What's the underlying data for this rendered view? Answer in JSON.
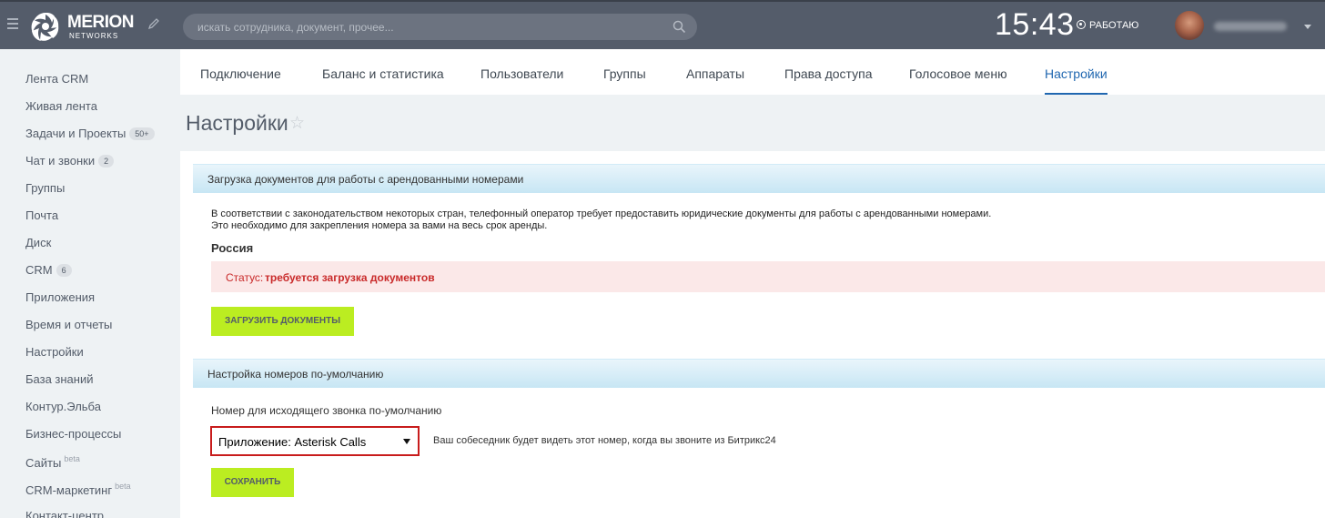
{
  "header": {
    "logo_text": "MERION",
    "logo_sub": "NETWORKS",
    "search_placeholder": "искать сотрудника, документ, прочее...",
    "time": "15:43",
    "work_status": "РАБОТАЮ",
    "user_name": ""
  },
  "sidebar": {
    "items": [
      {
        "label": "Лента CRM",
        "badge": "",
        "sup": ""
      },
      {
        "label": "Живая лента",
        "badge": "",
        "sup": ""
      },
      {
        "label": "Задачи и Проекты",
        "badge": "50+",
        "sup": ""
      },
      {
        "label": "Чат и звонки",
        "badge": "2",
        "sup": ""
      },
      {
        "label": "Группы",
        "badge": "",
        "sup": ""
      },
      {
        "label": "Почта",
        "badge": "",
        "sup": ""
      },
      {
        "label": "Диск",
        "badge": "",
        "sup": ""
      },
      {
        "label": "CRM",
        "badge": "6",
        "sup": ""
      },
      {
        "label": "Приложения",
        "badge": "",
        "sup": ""
      },
      {
        "label": "Время и отчеты",
        "badge": "",
        "sup": ""
      },
      {
        "label": "Настройки",
        "badge": "",
        "sup": ""
      },
      {
        "label": "База знаний",
        "badge": "",
        "sup": ""
      },
      {
        "label": "Контур.Эльба",
        "badge": "",
        "sup": ""
      },
      {
        "label": "Бизнес-процессы",
        "badge": "",
        "sup": ""
      },
      {
        "label": "Сайты",
        "badge": "",
        "sup": "beta"
      },
      {
        "label": "CRM-маркетинг",
        "badge": "",
        "sup": "beta"
      },
      {
        "label": "Контакт-центр",
        "badge": "",
        "sup": ""
      }
    ]
  },
  "tabs": [
    {
      "label": "Подключение",
      "active": false
    },
    {
      "label": "Баланс и статистика",
      "active": false
    },
    {
      "label": "Пользователи",
      "active": false
    },
    {
      "label": "Группы",
      "active": false
    },
    {
      "label": "Аппараты",
      "active": false
    },
    {
      "label": "Права доступа",
      "active": false
    },
    {
      "label": "Голосовое меню",
      "active": false
    },
    {
      "label": "Настройки",
      "active": true
    }
  ],
  "page": {
    "title": "Настройки",
    "star": "☆"
  },
  "docs_section": {
    "title": "Загрузка документов для работы с арендованными номерами",
    "desc_line1": "В соответствии с законодательством некоторых стран, телефонный оператор требует предоставить юридические документы для работы с арендованными номерами.",
    "desc_line2": "Это необходимо для закрепления номера за вами на весь срок аренды.",
    "country": "Россия",
    "status_label": "Статус:",
    "status_value": "требуется загрузка документов",
    "upload_button": "ЗАГРУЗИТЬ ДОКУМЕНТЫ"
  },
  "numbers_section": {
    "title": "Настройка номеров по-умолчанию",
    "field_label": "Номер для исходящего звонка по-умолчанию",
    "selected_value": "Приложение: Asterisk Calls",
    "hint": "Ваш собеседник будет видеть этот номер, когда вы звоните из Битрикс24",
    "save_button": "СОХРАНИТЬ"
  },
  "colors": {
    "topbar": "#545c6a",
    "accent_tab": "#2067b0",
    "button_green": "#bbed21",
    "error_red": "#c92a2a"
  }
}
